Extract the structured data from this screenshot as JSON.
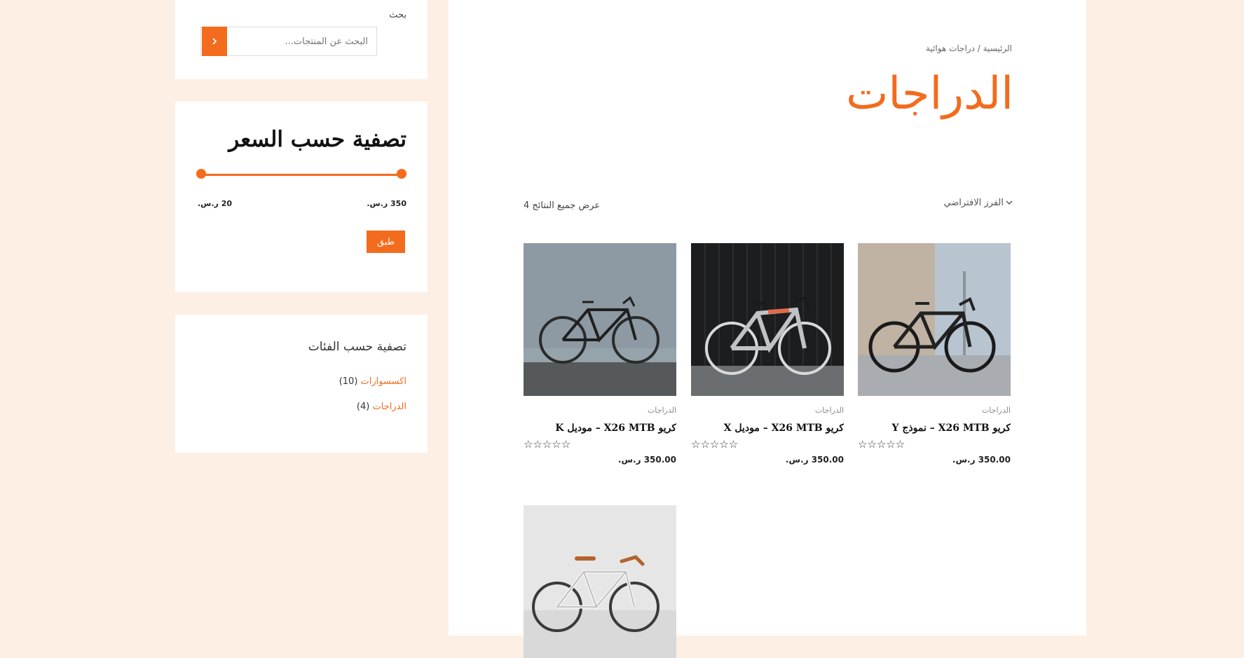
{
  "colors": {
    "accent": "#f36b1c",
    "page_bg": "#fdefe4"
  },
  "search": {
    "title": "بحث",
    "placeholder": "البحث عن المنتجات...",
    "button_icon": "chevron-right-icon"
  },
  "price_filter": {
    "title": "تصفية حسب السعر",
    "min_label": "20 ر.س.",
    "max_label": "350 ر.س.",
    "range_min": 20,
    "range_max": 350,
    "apply_label": "طبق"
  },
  "category_filter": {
    "title": "تصفية حسب الفئات",
    "items": [
      {
        "name": "اكسسوارات",
        "count": "(10)"
      },
      {
        "name": "الدراجات",
        "count": "(4)"
      }
    ]
  },
  "breadcrumb": {
    "home": "الرئيسية",
    "separator": "/",
    "current": "دراجات هوائية"
  },
  "page_title": "الدراجات",
  "sort": {
    "selected": "الفرز الافتراضي",
    "icon": "sort-chevron-icon"
  },
  "result_count": "عرض جميع النتائج 4",
  "products": [
    {
      "category": "الدراجات",
      "name": "كريو X26 MTB – نموذج Y",
      "rating": "0 of 5",
      "price": "350.00 ر.س."
    },
    {
      "category": "الدراجات",
      "name": "كريو X26 MTB – موديل X",
      "rating": "0 of 5",
      "price": "350.00 ر.س."
    },
    {
      "category": "الدراجات",
      "name": "كريو X26 MTB – موديل K",
      "rating": "0 of 5",
      "price": "350.00 ر.س."
    },
    {
      "category": "",
      "name": "",
      "rating": "",
      "price": ""
    }
  ]
}
